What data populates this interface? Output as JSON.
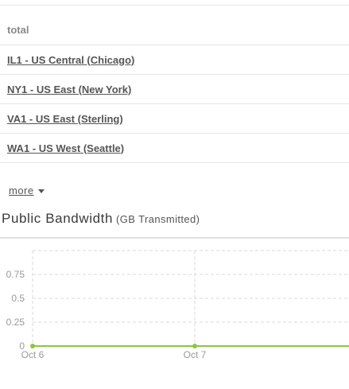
{
  "locations": {
    "header": "total",
    "rows": [
      "IL1 - US Central (Chicago)",
      "NY1 - US East (New York)",
      "VA1 - US East (Sterling)",
      "WA1 - US West (Seattle)"
    ]
  },
  "more_label": "more",
  "chart_title": "Public Bandwidth",
  "chart_subtitle": "(GB Transmitted)",
  "colors": {
    "series": "#8cc63f",
    "grid": "#d9d9d9",
    "text": "#555555"
  },
  "chart_data": {
    "type": "line",
    "title": "Public Bandwidth",
    "subtitle": "(GB Transmitted)",
    "x": [
      "Oct 6",
      "Oct 7"
    ],
    "series": [
      {
        "values": [
          0,
          0
        ]
      }
    ],
    "y_ticks": [
      "0",
      "0.25",
      "0.5",
      "0.75"
    ],
    "ylim": [
      0,
      1
    ],
    "grid": true
  }
}
